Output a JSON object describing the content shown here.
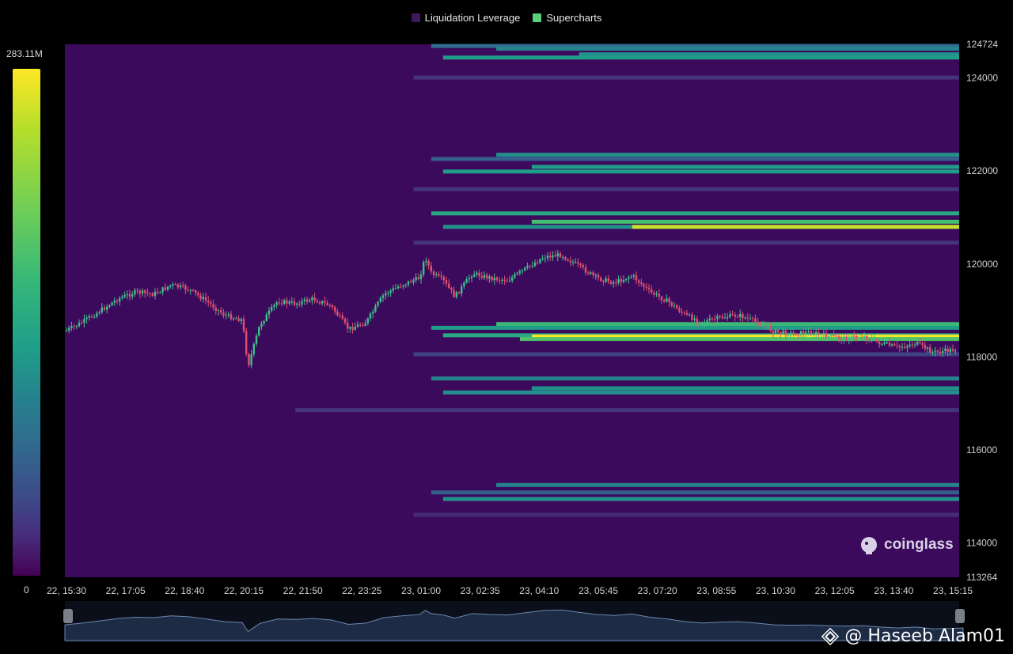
{
  "legend": [
    {
      "label": "Liquidation Leverage",
      "color": "#3b1a5a"
    },
    {
      "label": "Supercharts",
      "color": "#5ad07a"
    }
  ],
  "colorbar": {
    "max_label": "283.11M",
    "min_label": "0"
  },
  "logo": {
    "text": "coinglass",
    "icon": "coinglass-logo-icon"
  },
  "watermark": {
    "text": "@ Haseeb Alam01",
    "icon": "binance-diamond-icon"
  },
  "chart_data": {
    "type": "heatmap",
    "x_ticks": [
      "22, 15:30",
      "22, 17:05",
      "22, 18:40",
      "22, 20:15",
      "22, 21:50",
      "22, 23:25",
      "23, 01:00",
      "23, 02:35",
      "23, 04:10",
      "23, 05:45",
      "23, 07:20",
      "23, 08:55",
      "23, 10:30",
      "23, 12:05",
      "23, 13:40",
      "23, 15:15"
    ],
    "y_ticks": [
      124724,
      124000,
      122000,
      120000,
      118000,
      116000,
      114000,
      113264
    ],
    "ylim": [
      113264,
      124724
    ],
    "colorscale": "viridis",
    "value_range": [
      0,
      283.11
    ],
    "value_unit": "M",
    "liquidation_bands": [
      {
        "price": 124680,
        "start": 6.2,
        "level": 0.35
      },
      {
        "price": 124620,
        "start": 7.3,
        "level": 0.45
      },
      {
        "price": 124500,
        "start": 8.7,
        "level": 0.5
      },
      {
        "price": 124430,
        "start": 6.4,
        "level": 0.55
      },
      {
        "price": 124000,
        "start": 5.9,
        "level": 0.15
      },
      {
        "price": 122340,
        "start": 7.3,
        "level": 0.5
      },
      {
        "price": 122250,
        "start": 6.2,
        "level": 0.3
      },
      {
        "price": 122080,
        "start": 7.9,
        "level": 0.55
      },
      {
        "price": 121980,
        "start": 6.4,
        "level": 0.55
      },
      {
        "price": 121600,
        "start": 5.9,
        "level": 0.15
      },
      {
        "price": 121080,
        "start": 6.2,
        "level": 0.6
      },
      {
        "price": 120900,
        "start": 7.9,
        "level": 0.7
      },
      {
        "price": 120790,
        "start": 6.4,
        "level": 0.5
      },
      {
        "price": 120790,
        "start": 9.6,
        "level": 0.92
      },
      {
        "price": 120450,
        "start": 5.9,
        "level": 0.15
      },
      {
        "price": 118700,
        "start": 7.3,
        "level": 0.68
      },
      {
        "price": 118620,
        "start": 6.2,
        "level": 0.55
      },
      {
        "price": 118460,
        "start": 6.4,
        "level": 0.6
      },
      {
        "price": 118430,
        "start": 7.9,
        "level": 1.0
      },
      {
        "price": 118380,
        "start": 7.7,
        "level": 0.72
      },
      {
        "price": 118050,
        "start": 5.9,
        "level": 0.2
      },
      {
        "price": 117530,
        "start": 6.2,
        "level": 0.45
      },
      {
        "price": 117320,
        "start": 7.9,
        "level": 0.5
      },
      {
        "price": 117230,
        "start": 6.4,
        "level": 0.5
      },
      {
        "price": 116850,
        "start": 3.9,
        "level": 0.15
      },
      {
        "price": 115240,
        "start": 7.3,
        "level": 0.45
      },
      {
        "price": 115080,
        "start": 6.2,
        "level": 0.3
      },
      {
        "price": 114940,
        "start": 6.4,
        "level": 0.5
      },
      {
        "price": 114600,
        "start": 5.9,
        "level": 0.12
      }
    ],
    "price_series": {
      "name": "Supercharts",
      "x": [
        0,
        0.3,
        0.6,
        0.9,
        1.2,
        1.5,
        1.8,
        2.1,
        2.4,
        2.7,
        3.0,
        3.1,
        3.3,
        3.6,
        3.9,
        4.2,
        4.5,
        4.8,
        5.1,
        5.4,
        5.7,
        6.0,
        6.1,
        6.2,
        6.4,
        6.6,
        6.9,
        7.2,
        7.5,
        7.8,
        8.1,
        8.4,
        8.7,
        9.0,
        9.3,
        9.6,
        9.9,
        10.2,
        10.5,
        10.8,
        11.1,
        11.4,
        11.7,
        12.0,
        12.3,
        12.6,
        12.9,
        13.2,
        13.5,
        13.8,
        14.1,
        14.4,
        14.7,
        15.0,
        15.2
      ],
      "y": [
        118550,
        118750,
        119000,
        119250,
        119400,
        119350,
        119550,
        119450,
        119200,
        118900,
        118800,
        117800,
        118700,
        119200,
        119150,
        119250,
        119100,
        118600,
        118750,
        119350,
        119550,
        119700,
        120150,
        119800,
        119650,
        119300,
        119800,
        119700,
        119650,
        119900,
        120150,
        120200,
        119950,
        119700,
        119600,
        119750,
        119400,
        119200,
        118900,
        118750,
        118850,
        118900,
        118750,
        118550,
        118500,
        118530,
        118450,
        118400,
        118450,
        118300,
        118200,
        118300,
        118100,
        118150,
        118200
      ]
    }
  }
}
